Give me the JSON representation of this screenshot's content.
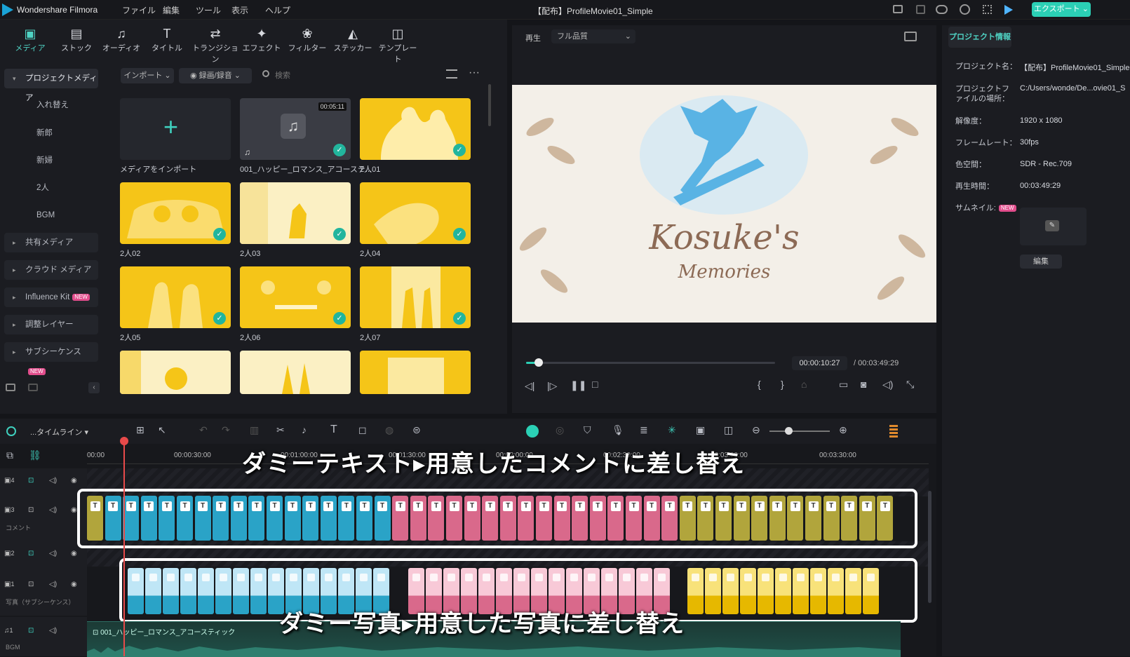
{
  "app": {
    "name": "Wondershare Filmora",
    "title": "【配布】ProfileMovie01_Simple",
    "menu": [
      "ファイル",
      "編集",
      "ツール",
      "表示",
      "ヘルプ"
    ],
    "export_label": "エクスポート"
  },
  "toolbar": {
    "items": [
      {
        "label": "メディア",
        "icon": "media-icon"
      },
      {
        "label": "ストック",
        "icon": "stock-icon"
      },
      {
        "label": "オーディオ",
        "icon": "music-note-icon"
      },
      {
        "label": "タイトル",
        "icon": "title-t-icon"
      },
      {
        "label": "トランジション",
        "icon": "transition-icon"
      },
      {
        "label": "エフェクト",
        "icon": "effect-icon"
      },
      {
        "label": "フィルター",
        "icon": "filter-icon"
      },
      {
        "label": "ステッカー",
        "icon": "sticker-icon"
      },
      {
        "label": "テンプレート",
        "icon": "template-icon"
      }
    ]
  },
  "sidebar": {
    "project_media": "プロジェクトメディア",
    "folders": [
      "入れ替え",
      "新郎",
      "新婦",
      "2人",
      "BGM"
    ],
    "groups": [
      {
        "label": "共有メディア",
        "new": false
      },
      {
        "label": "クラウド メディア",
        "new": false
      },
      {
        "label": "Influence Kit",
        "new": true
      },
      {
        "label": "調整レイヤー",
        "new": false
      },
      {
        "label": "サブシーケンス",
        "new": true
      }
    ],
    "new_badge": "NEW"
  },
  "media": {
    "import_dropdown": "インポート",
    "record_dropdown": "録画/録音",
    "search_placeholder": "検索",
    "import_tile_label": "メディアをインポート",
    "audio_duration": "00:05:11",
    "items": [
      "001_ハッピー_ロマンス_アコーステ...",
      "2人01",
      "2人02",
      "2人03",
      "2人04",
      "2人05",
      "2人06",
      "2人07"
    ]
  },
  "preview": {
    "play_label": "再生",
    "quality": "フル品質",
    "current_time": "00:00:10:27",
    "total_time": "/ 00:03:49:29",
    "progress": 0.05,
    "title_main": "Kosuke's",
    "title_sub": "Memories"
  },
  "props": {
    "tab": "プロジェクト情報",
    "rows": [
      {
        "label": "プロジェクト名：",
        "value": "【配布】ProfileMovie01_Simple"
      },
      {
        "label": "プロジェクトファイルの場所：",
        "value": "C:/Users/wonde/De...ovie01_S"
      },
      {
        "label": "解像度：",
        "value": "1920 x 1080"
      },
      {
        "label": "フレームレート：",
        "value": "30fps"
      },
      {
        "label": "色空間：",
        "value": "SDR - Rec.709"
      },
      {
        "label": "再生時間：",
        "value": "00:03:49:29"
      },
      {
        "label": "サムネイル:",
        "value": ""
      }
    ],
    "edit_button": "編集"
  },
  "timeline": {
    "name": "...タイムライン",
    "ruler": [
      "00:00",
      "00:00:30:00",
      "00:01:00:00",
      "00:01:30:00",
      "00:02:00:00",
      "00:02:30:00",
      "00:03:00:00",
      "00:03:30:00"
    ],
    "tracks": [
      {
        "num": "4",
        "label": ""
      },
      {
        "num": "3",
        "label": "コメント"
      },
      {
        "num": "2",
        "label": ""
      },
      {
        "num": "1",
        "label": "写真（サブシーケンス）"
      },
      {
        "num": "1",
        "label": "BGM"
      }
    ],
    "bgm_clip": "001_ハッピー_ロマンス_アコースティック",
    "overlay_top": "ダミーテキスト▸用意したコメントに差し替え",
    "overlay_bottom": "ダミー写真▸用意した写真に差し替え",
    "colors": {
      "gold": "#b1a53c",
      "blue": "#2aa3c7",
      "pink": "#d9698b",
      "accent": "#4fd3c4"
    }
  }
}
